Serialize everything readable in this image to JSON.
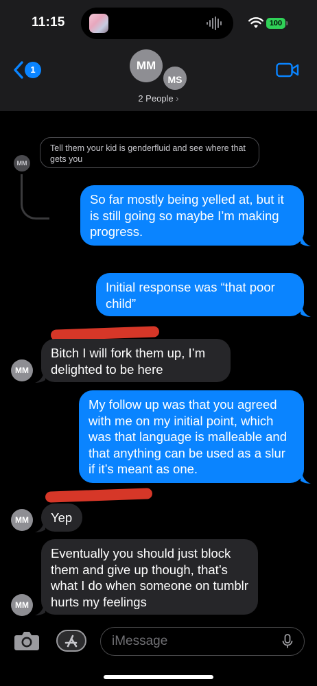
{
  "status_bar": {
    "time": "11:15",
    "battery": "100"
  },
  "header": {
    "back_badge": "1",
    "avatar_primary": "MM",
    "avatar_secondary": "MS",
    "people_label": "2 People",
    "people_chevron": "›"
  },
  "reply_context": {
    "text": "Tell them your kid is genderfluid and see where that gets you",
    "avatar": "MM"
  },
  "messages": [
    {
      "from": "me",
      "text": "So far mostly being yelled at, but it is still going so maybe I’m making progress."
    },
    {
      "from": "me",
      "text": "Initial response was “that poor child”"
    },
    {
      "from": "MM",
      "text": "Bitch I will fork them up, I’m delighted to be here"
    },
    {
      "from": "me",
      "text": "My follow up was that you agreed with me on my initial point, which was that language is malleable and that anything can be used as a slur if it’s meant as one."
    },
    {
      "from": "MM",
      "text": "Yep"
    },
    {
      "from": "MM",
      "text": "Eventually you should just block them and give up though, that’s what I do when someone on tumblr hurts my feelings"
    }
  ],
  "composer": {
    "placeholder": "iMessage"
  },
  "colors": {
    "sent": "#0a84ff",
    "received": "#262629",
    "redaction": "#e23a2a",
    "battery": "#30d158"
  },
  "icons": [
    "back-chevron-icon",
    "video-camera-icon",
    "camera-icon",
    "app-store-icon",
    "microphone-icon",
    "wifi-icon",
    "audio-wave-icon"
  ]
}
